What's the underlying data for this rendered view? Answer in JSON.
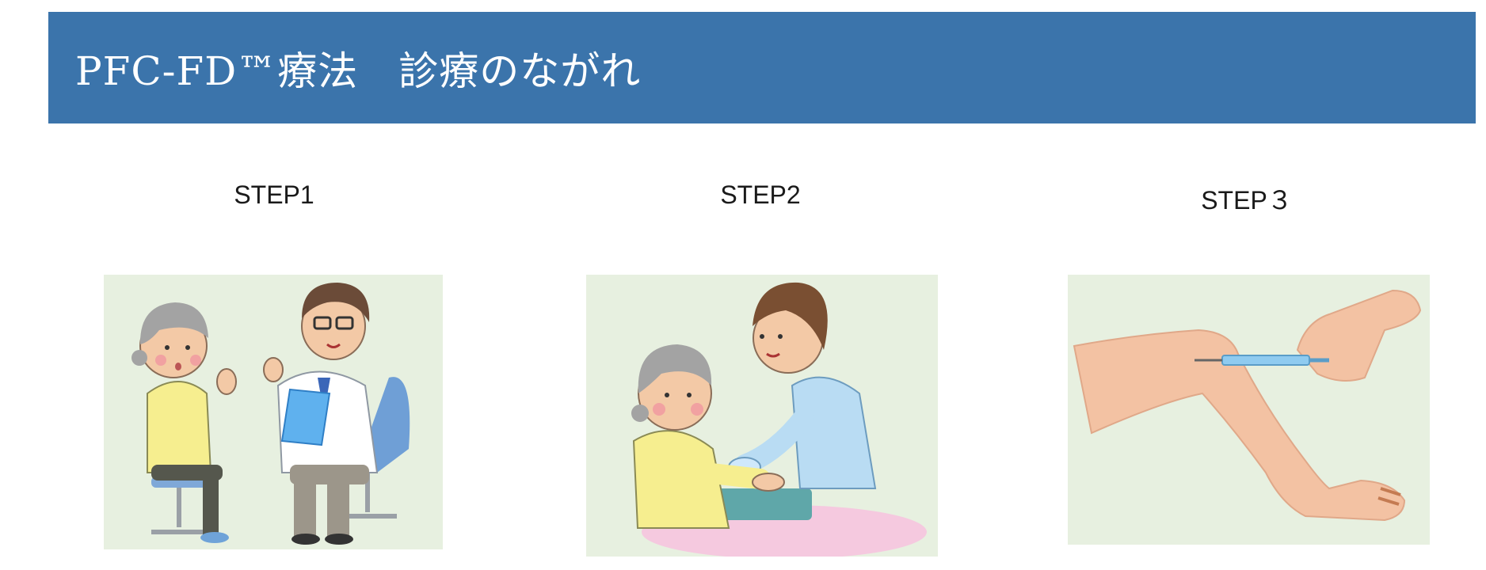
{
  "header": {
    "title": "PFC-FD™療法　診療のながれ"
  },
  "steps": [
    {
      "label": "STEP1",
      "illustration": "consultation-illustration"
    },
    {
      "label": "STEP2",
      "illustration": "blood-draw-illustration"
    },
    {
      "label": "STEP３",
      "illustration": "knee-injection-illustration"
    }
  ],
  "colors": {
    "header_bg": "#3b74ab",
    "header_text": "#ffffff",
    "illustration_bg": "#e7f0e0"
  }
}
